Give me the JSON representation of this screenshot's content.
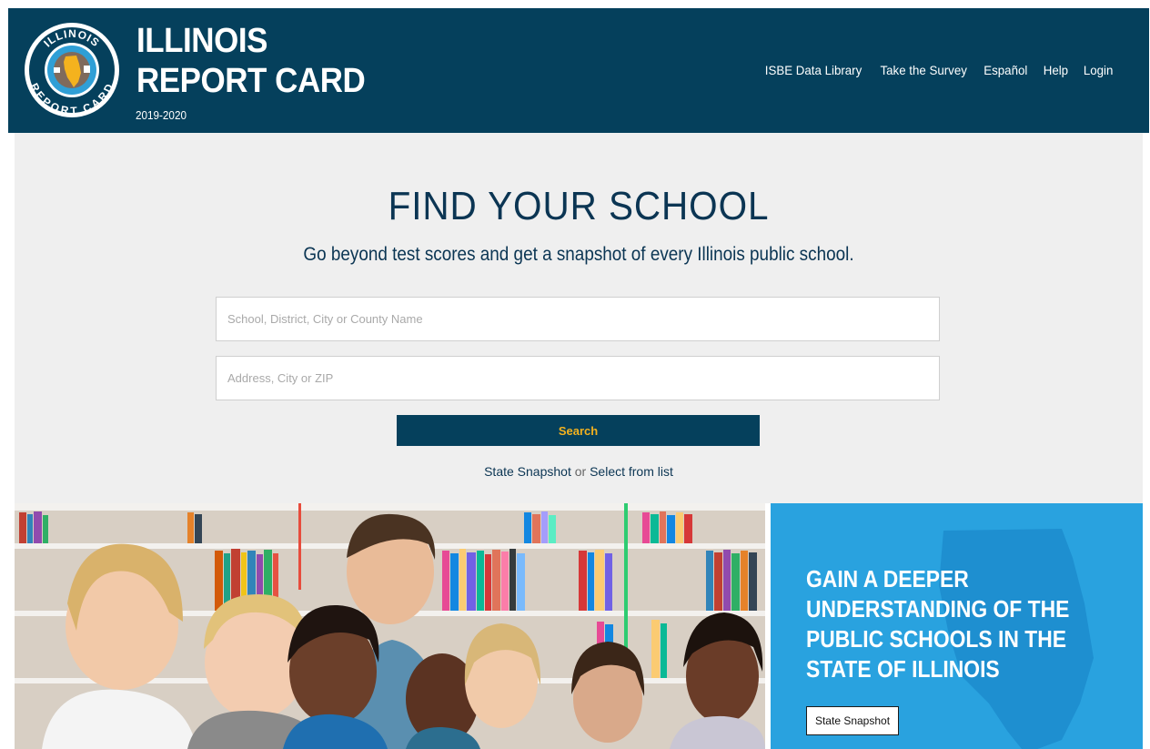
{
  "header": {
    "logo": {
      "ring_text_top": "ILLINOIS",
      "ring_text_bottom": "REPORT CARD",
      "icon": "illinois-state-icon"
    },
    "title_line1": "ILLINOIS",
    "title_line2": "REPORT CARD",
    "year": "2019-2020",
    "nav": [
      {
        "label": "ISBE Data Library"
      },
      {
        "label": "Take the Survey"
      },
      {
        "label": "Español"
      },
      {
        "label": "Help"
      },
      {
        "label": "Login"
      }
    ]
  },
  "search": {
    "title": "FIND YOUR SCHOOL",
    "subtitle": "Go beyond test scores and get a snapshot of every Illinois public school.",
    "school_field": {
      "placeholder": "School, District, City or County Name",
      "value": ""
    },
    "address_field": {
      "placeholder": "Address, City or ZIP",
      "value": ""
    },
    "search_label": "Search",
    "link_state_snapshot": "State Snapshot",
    "link_separator": "or",
    "link_select_list": "Select from list"
  },
  "photo": {
    "subject": "students-in-library-photo"
  },
  "promo": {
    "text": "GAIN A DEEPER UNDERSTANDING OF THE PUBLIC SCHOOLS IN THE STATE OF ILLINOIS",
    "button_label": "State Snapshot"
  },
  "colors": {
    "header_bg": "#05405c",
    "hero_bg": "#efefef",
    "title_text": "#0b3553",
    "search_button_text": "#f4b21e",
    "promo_bg": "#29a2df",
    "map_overlay": "#1e8fd0"
  }
}
